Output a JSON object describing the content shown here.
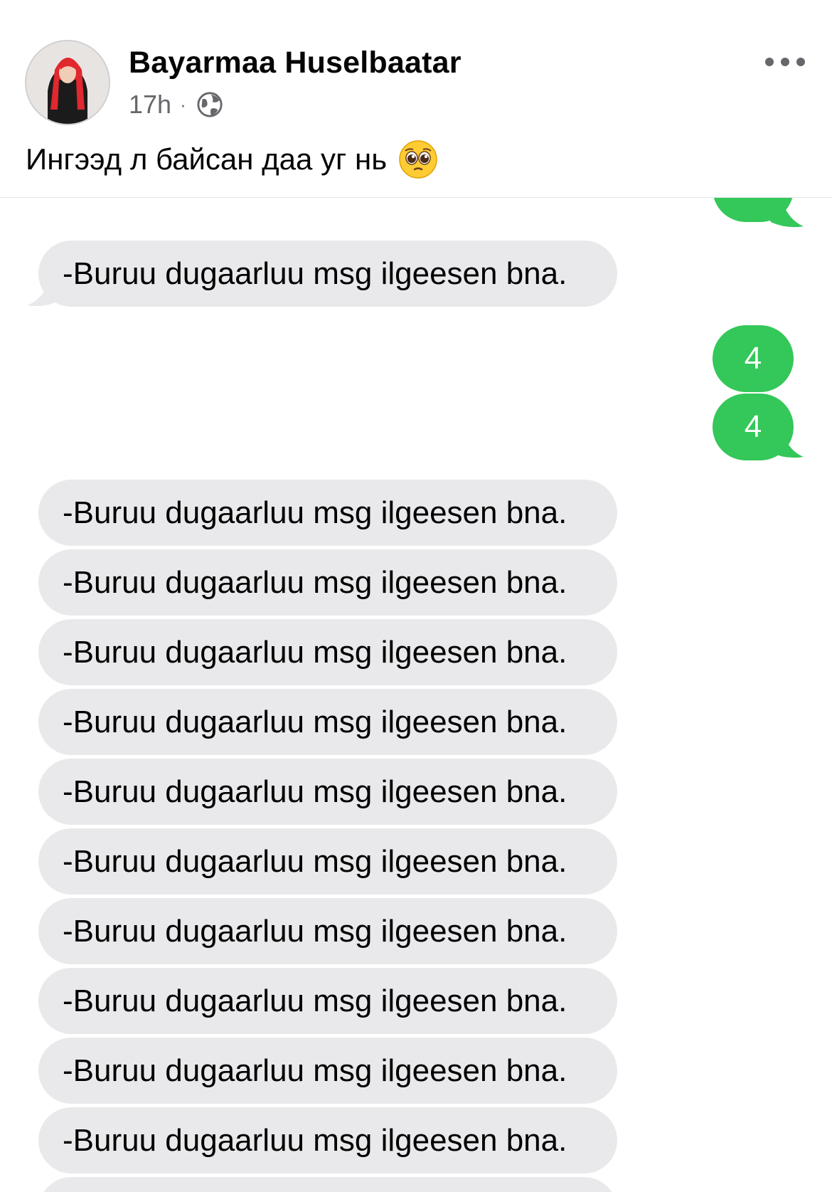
{
  "post": {
    "author": "Bayarmaa Huselbaatar",
    "time": "17h",
    "separator": "·",
    "privacy_icon": "globe-icon",
    "more_icon": "more-dots-icon",
    "caption": "Ингээд л байсан даа уг нь",
    "caption_emoji": "pleading-face-emoji"
  },
  "chat": {
    "received_text": "-Buruu dugaarluu msg ilgeesen bna.",
    "sent_messages": [
      "4",
      "4"
    ],
    "received_repeated": [
      "-Buruu dugaarluu msg ilgeesen bna.",
      "-Buruu dugaarluu msg ilgeesen bna.",
      "-Buruu dugaarluu msg ilgeesen bna.",
      "-Buruu dugaarluu msg ilgeesen bna.",
      "-Buruu dugaarluu msg ilgeesen bna.",
      "-Buruu dugaarluu msg ilgeesen bna.",
      "-Buruu dugaarluu msg ilgeesen bna.",
      "-Buruu dugaarluu msg ilgeesen bna.",
      "-Buruu dugaarluu msg ilgeesen bna.",
      "-Buruu dugaarluu msg ilgeesen bna."
    ]
  },
  "colors": {
    "sent_bubble": "#34c759",
    "received_bubble": "#e9e9eb",
    "meta_text": "#65676b"
  }
}
